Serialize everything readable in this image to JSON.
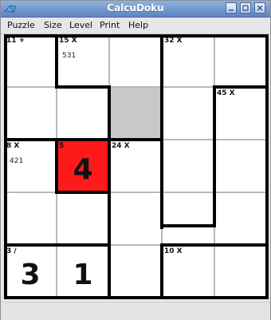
{
  "window": {
    "title": "CalcuDoku"
  },
  "menu": [
    "Puzzle",
    "Size",
    "Level",
    "Print",
    "Help"
  ],
  "board": {
    "size": 5,
    "cells": [
      {
        "row": 0,
        "col": 0,
        "label": "11 +",
        "notes": "",
        "value": ""
      },
      {
        "row": 0,
        "col": 1,
        "label": "15 X",
        "notes": "531",
        "value": ""
      },
      {
        "row": 0,
        "col": 2,
        "label": "",
        "notes": "",
        "value": ""
      },
      {
        "row": 0,
        "col": 3,
        "label": "32 X",
        "notes": "",
        "value": ""
      },
      {
        "row": 0,
        "col": 4,
        "label": "",
        "notes": "",
        "value": ""
      },
      {
        "row": 1,
        "col": 0,
        "label": "",
        "notes": "",
        "value": ""
      },
      {
        "row": 1,
        "col": 1,
        "label": "",
        "notes": "",
        "value": ""
      },
      {
        "row": 1,
        "col": 2,
        "label": "",
        "notes": "",
        "value": "",
        "state": "selected"
      },
      {
        "row": 1,
        "col": 3,
        "label": "",
        "notes": "",
        "value": ""
      },
      {
        "row": 1,
        "col": 4,
        "label": "45 X",
        "notes": "",
        "value": ""
      },
      {
        "row": 2,
        "col": 0,
        "label": "8 X",
        "notes": "421",
        "value": ""
      },
      {
        "row": 2,
        "col": 1,
        "label": "5",
        "notes": "",
        "value": "4",
        "state": "error"
      },
      {
        "row": 2,
        "col": 2,
        "label": "24 X",
        "notes": "",
        "value": ""
      },
      {
        "row": 2,
        "col": 3,
        "label": "",
        "notes": "",
        "value": ""
      },
      {
        "row": 2,
        "col": 4,
        "label": "",
        "notes": "",
        "value": ""
      },
      {
        "row": 3,
        "col": 0,
        "label": "",
        "notes": "",
        "value": ""
      },
      {
        "row": 3,
        "col": 1,
        "label": "",
        "notes": "",
        "value": ""
      },
      {
        "row": 3,
        "col": 2,
        "label": "",
        "notes": "",
        "value": ""
      },
      {
        "row": 3,
        "col": 3,
        "label": "",
        "notes": "",
        "value": ""
      },
      {
        "row": 3,
        "col": 4,
        "label": "",
        "notes": "",
        "value": ""
      },
      {
        "row": 4,
        "col": 0,
        "label": "3 /",
        "notes": "",
        "value": "3"
      },
      {
        "row": 4,
        "col": 1,
        "label": "",
        "notes": "",
        "value": "1"
      },
      {
        "row": 4,
        "col": 2,
        "label": "",
        "notes": "",
        "value": ""
      },
      {
        "row": 4,
        "col": 3,
        "label": "10 X",
        "notes": "",
        "value": ""
      },
      {
        "row": 4,
        "col": 4,
        "label": "",
        "notes": "",
        "value": ""
      }
    ]
  },
  "colors": {
    "selected_cell": "#c8c8c8",
    "error_cell": "#ff1a1a",
    "titlebar": "#6f93cc"
  },
  "icons": {
    "app": "app-icon",
    "minimize": "minimize-icon",
    "maximize": "maximize-icon",
    "close": "close-icon"
  }
}
